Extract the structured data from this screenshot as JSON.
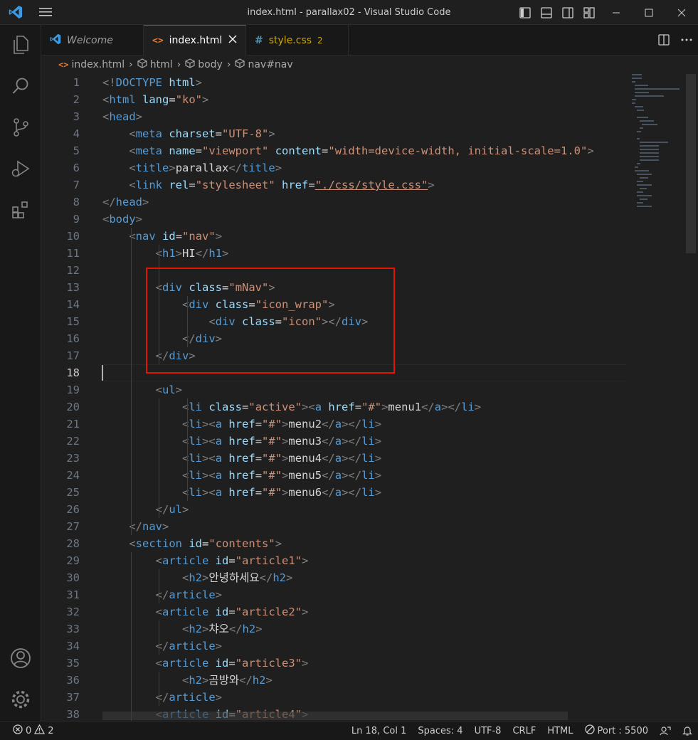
{
  "window": {
    "title": "index.html - parallax02 - Visual Studio Code"
  },
  "tabs": [
    {
      "label": "Welcome",
      "icon": "vscode-icon"
    },
    {
      "label": "index.html",
      "icon": "html-icon",
      "active": true
    },
    {
      "label": "style.css",
      "icon": "css-icon",
      "badge": "2"
    }
  ],
  "breadcrumb": {
    "items": [
      "index.html",
      "html",
      "body",
      "nav#nav"
    ]
  },
  "editor": {
    "current_line": 18,
    "lines": [
      {
        "n": "1",
        "text": "<!DOCTYPE html>"
      },
      {
        "n": "2",
        "text": "<html lang=\"ko\">"
      },
      {
        "n": "3",
        "text": "<head>"
      },
      {
        "n": "4",
        "text": "    <meta charset=\"UTF-8\">"
      },
      {
        "n": "5",
        "text": "    <meta name=\"viewport\" content=\"width=device-width, initial-scale=1.0\">"
      },
      {
        "n": "6",
        "text": "    <title>parallax</title>"
      },
      {
        "n": "7",
        "text": "    <link rel=\"stylesheet\" href=\"./css/style.css\">"
      },
      {
        "n": "8",
        "text": "</head>"
      },
      {
        "n": "9",
        "text": "<body>"
      },
      {
        "n": "10",
        "text": "    <nav id=\"nav\">"
      },
      {
        "n": "11",
        "text": "        <h1>HI</h1>"
      },
      {
        "n": "12",
        "text": ""
      },
      {
        "n": "13",
        "text": "        <div class=\"mNav\">"
      },
      {
        "n": "14",
        "text": "            <div class=\"icon_wrap\">"
      },
      {
        "n": "15",
        "text": "                <div class=\"icon\"></div>"
      },
      {
        "n": "16",
        "text": "            </div>"
      },
      {
        "n": "17",
        "text": "        </div>"
      },
      {
        "n": "18",
        "text": ""
      },
      {
        "n": "19",
        "text": "        <ul>"
      },
      {
        "n": "20",
        "text": "            <li class=\"active\"><a href=\"#\">menu1</a></li>"
      },
      {
        "n": "21",
        "text": "            <li><a href=\"#\">menu2</a></li>"
      },
      {
        "n": "22",
        "text": "            <li><a href=\"#\">menu3</a></li>"
      },
      {
        "n": "23",
        "text": "            <li><a href=\"#\">menu4</a></li>"
      },
      {
        "n": "24",
        "text": "            <li><a href=\"#\">menu5</a></li>"
      },
      {
        "n": "25",
        "text": "            <li><a href=\"#\">menu6</a></li>"
      },
      {
        "n": "26",
        "text": "        </ul>"
      },
      {
        "n": "27",
        "text": "    </nav>"
      },
      {
        "n": "28",
        "text": "    <section id=\"contents\">"
      },
      {
        "n": "29",
        "text": "        <article id=\"article1\">"
      },
      {
        "n": "30",
        "text": "            <h2>안녕하세요</h2>"
      },
      {
        "n": "31",
        "text": "        </article>"
      },
      {
        "n": "32",
        "text": "        <article id=\"article2\">"
      },
      {
        "n": "33",
        "text": "            <h2>챠오</h2>"
      },
      {
        "n": "34",
        "text": "        </article>"
      },
      {
        "n": "35",
        "text": "        <article id=\"article3\">"
      },
      {
        "n": "36",
        "text": "            <h2>곰방와</h2>"
      },
      {
        "n": "37",
        "text": "        </article>"
      },
      {
        "n": "38",
        "text": "        <article id=\"article4\">"
      }
    ]
  },
  "statusbar": {
    "errors": "0",
    "warnings": "2",
    "position": "Ln 18, Col 1",
    "spaces": "Spaces: 4",
    "encoding": "UTF-8",
    "eol": "CRLF",
    "language": "HTML",
    "port": "Port : 5500"
  },
  "colors": {
    "accent": "#0078d4",
    "highlight_box": "#e51400",
    "tag": "#569cd6",
    "attr": "#9cdcfe",
    "string": "#ce9178"
  }
}
